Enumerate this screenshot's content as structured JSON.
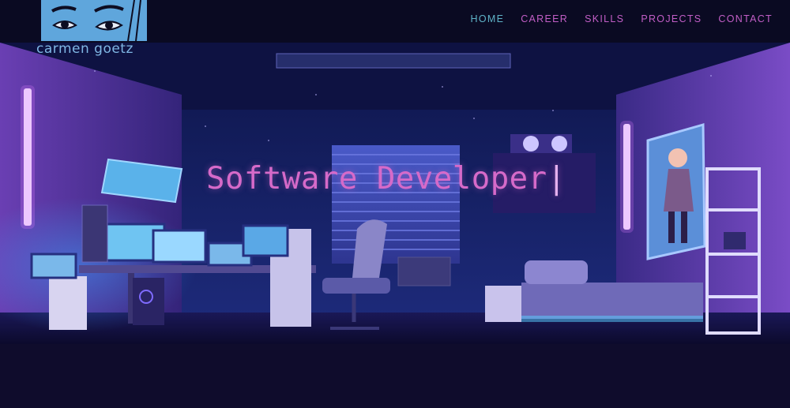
{
  "logo": {
    "text": "carmen goetz",
    "icon": "face-eyes-icon"
  },
  "nav": {
    "items": [
      {
        "label": "HOME",
        "active": true
      },
      {
        "label": "CAREER",
        "active": false
      },
      {
        "label": "SKILLS",
        "active": false
      },
      {
        "label": "PROJECTS",
        "active": false
      },
      {
        "label": "CONTACT",
        "active": false
      }
    ],
    "active_color": "#5fb3c8",
    "color": "#c25ec6"
  },
  "hero": {
    "headline": "Software Developer",
    "cursor": "|",
    "headline_color": "#d66ac9"
  }
}
